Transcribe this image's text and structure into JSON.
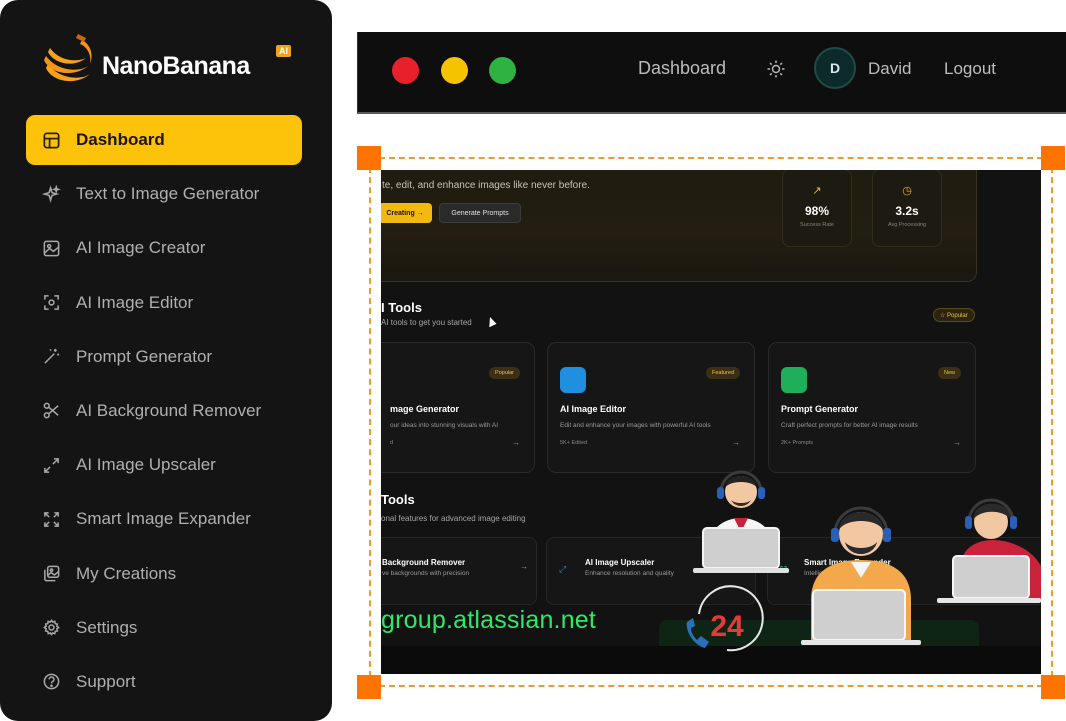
{
  "sidebar": {
    "logo_text": "NanoBanana",
    "logo_badge": "AI",
    "items": [
      {
        "label": "Dashboard",
        "icon": "layout-icon",
        "active": true
      },
      {
        "label": "Text to Image Generator",
        "icon": "sparkles-icon"
      },
      {
        "label": "AI Image Creator",
        "icon": "image-icon"
      },
      {
        "label": "AI Image Editor",
        "icon": "scan-icon"
      },
      {
        "label": "Prompt Generator",
        "icon": "magic-wand-icon"
      },
      {
        "label": "AI Background Remover",
        "icon": "scissors-icon"
      },
      {
        "label": "AI Image Upscaler",
        "icon": "expand-arrows-icon"
      },
      {
        "label": "Smart Image Expander",
        "icon": "expand-corners-icon"
      },
      {
        "label": "My Creations",
        "icon": "gallery-icon"
      },
      {
        "label": "Settings",
        "icon": "gear-icon"
      },
      {
        "label": "Support",
        "icon": "help-circle-icon"
      }
    ]
  },
  "topbar": {
    "nav_label": "Dashboard",
    "avatar_initial": "D",
    "user_name": "David",
    "logout_label": "Logout"
  },
  "screen": {
    "hero_subtitle": "te, edit, and enhance images like never before.",
    "start_button": "Creating →",
    "prompts_button": "Generate Prompts",
    "stats": [
      {
        "value": "98%",
        "label": "Success Rate",
        "icon": "trend-up-icon"
      },
      {
        "value": "3.2s",
        "label": "Avg Processing",
        "icon": "clock-icon"
      }
    ],
    "section1_title": "I Tools",
    "section1_sub": "AI tools to get you started",
    "section1_badge": "☆ Popular",
    "cards": [
      {
        "title": "mage Generator",
        "desc": "our ideas into stunning visuals with AI",
        "meta": "d",
        "badge": "Popular",
        "icon_color": "#2a2a2a"
      },
      {
        "title": "AI Image Editor",
        "desc": "Edit and enhance your images with powerful AI tools",
        "meta": "5K+ Edited",
        "badge": "Featured",
        "icon_color": "#1f8fe0"
      },
      {
        "title": "Prompt Generator",
        "desc": "Craft perfect prompts for better AI image results",
        "meta": "2K+ Prompts",
        "badge": "New",
        "icon_color": "#1fae5a"
      }
    ],
    "section2_title": "Tools",
    "section2_sub": "onal features for advanced image editing",
    "cards2": [
      {
        "title": "Background Remover",
        "desc": "ve backgrounds with precision"
      },
      {
        "title": "AI Image Upscaler",
        "desc": "Enhance resolution and quality"
      },
      {
        "title": "Smart Image Expander",
        "desc": "Intelligent image dimensions"
      }
    ],
    "overlay_url": "group.atlassian.net",
    "support_number": "24"
  }
}
